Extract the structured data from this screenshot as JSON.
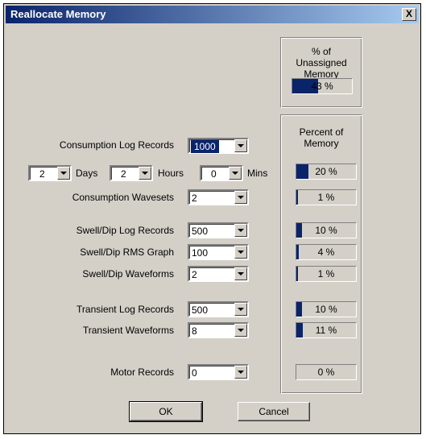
{
  "window": {
    "title": "Reallocate Memory",
    "close_label": "X"
  },
  "unassigned": {
    "title": "% of Unassigned Memory",
    "value_text": "43 %",
    "fraction": 0.43
  },
  "percent_group": {
    "title": "Percent of Memory"
  },
  "rows": [
    {
      "label": "Consumption Log Records",
      "value": "1000",
      "percent_text": "20 %",
      "fraction": 0.2
    },
    {
      "label": "Consumption Wavesets",
      "value": "2",
      "percent_text": "1 %",
      "fraction": 0.01
    },
    {
      "label": "Swell/Dip Log Records",
      "value": "500",
      "percent_text": "10 %",
      "fraction": 0.1
    },
    {
      "label": "Swell/Dip RMS Graph",
      "value": "100",
      "percent_text": "4 %",
      "fraction": 0.04
    },
    {
      "label": "Swell/Dip Waveforms",
      "value": "2",
      "percent_text": "1 %",
      "fraction": 0.01
    },
    {
      "label": "Transient Log Records",
      "value": "500",
      "percent_text": "10 %",
      "fraction": 0.1
    },
    {
      "label": "Transient Waveforms",
      "value": "8",
      "percent_text": "11 %",
      "fraction": 0.11
    },
    {
      "label": "Motor Records",
      "value": "0",
      "percent_text": "0 %",
      "fraction": 0.0
    }
  ],
  "duration": {
    "days_value": "2",
    "days_label": "Days",
    "hours_value": "2",
    "hours_label": "Hours",
    "mins_value": "0",
    "mins_label": "Mins"
  },
  "buttons": {
    "ok": "OK",
    "cancel": "Cancel"
  },
  "colors": {
    "fill": "#0a246a",
    "face": "#d4d0c8"
  }
}
